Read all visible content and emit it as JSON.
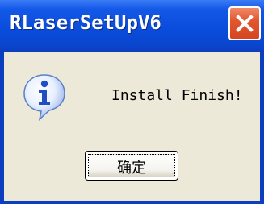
{
  "window": {
    "title": "RLaserSetUpV6"
  },
  "dialog": {
    "message": "Install Finish!",
    "icon": "info-icon"
  },
  "buttons": {
    "ok_label": "确定",
    "close_icon": "close-icon"
  },
  "colors": {
    "titlebar": "#0a4ddc",
    "close_button": "#e2572f",
    "client_background": "#ece9d8",
    "info_icon": "#2f64d4"
  }
}
